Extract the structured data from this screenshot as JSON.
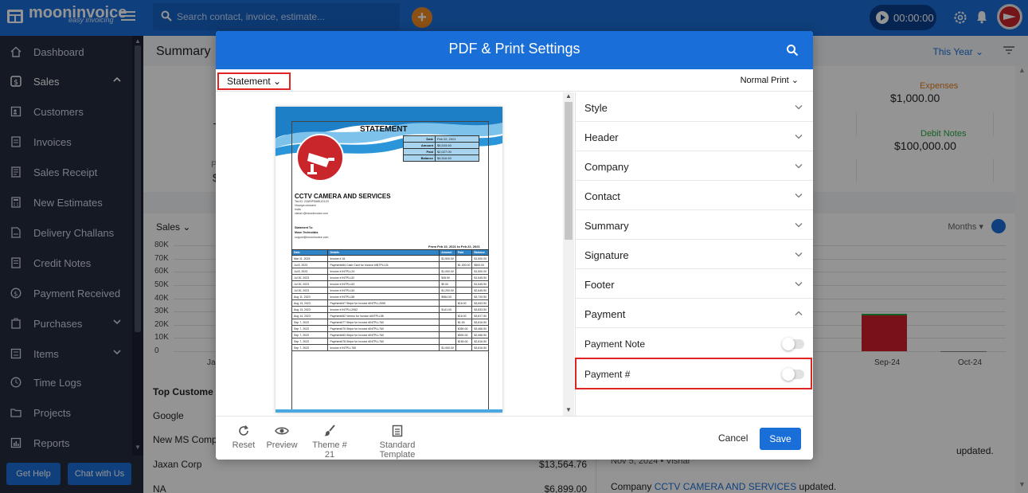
{
  "app": {
    "name": "mooninvoice",
    "tagline": "easy invoicing",
    "search_placeholder": "Search contact, invoice, estimate...",
    "timer": "00:00:00",
    "accent_color": "#1a6ed8"
  },
  "sidebar": {
    "items": [
      {
        "label": "Dashboard",
        "icon": "home-icon"
      },
      {
        "label": "Sales",
        "icon": "dollar-icon",
        "chevron": "up"
      },
      {
        "label": "Customers",
        "icon": "contact-card-icon"
      },
      {
        "label": "Invoices",
        "icon": "document-icon"
      },
      {
        "label": "Sales Receipt",
        "icon": "receipt-icon"
      },
      {
        "label": "New Estimates",
        "icon": "calculator-icon"
      },
      {
        "label": "Delivery Challans",
        "icon": "delivery-icon"
      },
      {
        "label": "Credit Notes",
        "icon": "note-icon"
      },
      {
        "label": "Payment Received",
        "icon": "payment-icon"
      },
      {
        "label": "Purchases",
        "icon": "purchase-icon",
        "chevron": "down"
      },
      {
        "label": "Items",
        "icon": "items-icon",
        "chevron": "down"
      },
      {
        "label": "Time Logs",
        "icon": "clock-icon"
      },
      {
        "label": "Projects",
        "icon": "folder-icon"
      },
      {
        "label": "Reports",
        "icon": "chart-icon"
      }
    ],
    "help_label": "Get Help",
    "chat_label": "Chat with Us"
  },
  "dashboard": {
    "summary_title": "Summary",
    "period": "This Year",
    "expenses_label": "Expenses",
    "expenses_value": "$1,000.00",
    "debit_notes_label": "Debit Notes",
    "debit_notes_value": "$100,000.00",
    "peek_label": "Pu",
    "peek_value": "$",
    "sales_label": "Sales",
    "months_label": "Months",
    "top_customers_title": "Top Custome",
    "top_customers": [
      {
        "name": "Google",
        "amount": ""
      },
      {
        "name": "New MS Comp",
        "amount": ""
      },
      {
        "name": "Jaxan Corp",
        "amount": "$13,564.76"
      },
      {
        "name": "NA",
        "amount": "$6,899.00"
      }
    ],
    "activity": {
      "updated_suffix": "updated.",
      "meta": "Nov 5, 2024 • Vishal",
      "line_prefix": "Company",
      "line_link": "CCTV CAMERA AND SERVICES",
      "line_suffix": "updated."
    }
  },
  "chart_data": {
    "type": "bar",
    "title": "Sales",
    "y_ticks": [
      "80K",
      "70K",
      "60K",
      "50K",
      "40K",
      "30K",
      "20K",
      "10K",
      "0"
    ],
    "ylim": [
      0,
      80000
    ],
    "categories_visible": [
      "Ja",
      "Sep-24",
      "Oct-24"
    ],
    "series": [
      {
        "color": "#cf1f2a",
        "values": {
          "Sep-24": 27000
        }
      },
      {
        "color": "#27a743",
        "values": {
          "Sep-24": 1500
        }
      }
    ],
    "grid": true
  },
  "modal": {
    "title": "PDF & Print Settings",
    "template_type": "Statement",
    "print_mode": "Normal Print",
    "settings": [
      {
        "label": "Style",
        "chevron": "down"
      },
      {
        "label": "Header",
        "chevron": "down"
      },
      {
        "label": "Company",
        "chevron": "down"
      },
      {
        "label": "Contact",
        "chevron": "down"
      },
      {
        "label": "Summary",
        "chevron": "down"
      },
      {
        "label": "Signature",
        "chevron": "down"
      },
      {
        "label": "Footer",
        "chevron": "down"
      },
      {
        "label": "Payment",
        "chevron": "up"
      }
    ],
    "payment_options": [
      {
        "label": "Payment Note",
        "enabled": false
      },
      {
        "label": "Payment #",
        "enabled": false
      }
    ],
    "footer": {
      "reset": "Reset",
      "preview": "Preview",
      "theme": "Theme # 21",
      "template": "Standard Template",
      "cancel": "Cancel",
      "save": "Save"
    }
  },
  "statement_doc": {
    "title": "STATEMENT",
    "meta": [
      {
        "k": "Date",
        "v": "Feb 22, 2021"
      },
      {
        "k": "Amount",
        "v": "$6,543.60"
      },
      {
        "k": "Paid",
        "v": "$2,027.00"
      },
      {
        "k": "Balance",
        "v": "$4,516.60"
      }
    ],
    "company": "CCTV CAMERA AND SERVICES",
    "company_lines": [
      "Tax ID: 22ARIPS6851G1ZX",
      "Visanya cressent",
      "India",
      "vishal.r@mooninvoice.com"
    ],
    "to_label": "Statement To:",
    "to_lines": [
      "Moon Technolabs",
      "support@mooninvoice.com"
    ],
    "period": "From Feb 22, 2021 to Feb 22, 2021",
    "columns": [
      "Date",
      "Details",
      "Amount",
      "Paid",
      "Balance"
    ],
    "rows": [
      [
        "Mar 11, 2023",
        "Invoice # 16",
        "$1,500.00",
        "",
        "$1,500.00"
      ],
      [
        "Jul 8, 2023",
        "Payment#64 Cash Card for Invoice #INTPLL24",
        "",
        "$1,000.00",
        "$500.00"
      ],
      [
        "Jul 8, 2023",
        "Invoice # INTPLL24",
        "$1,000.00",
        "",
        "$1,500.00"
      ],
      [
        "Jul 30, 2023",
        "Invoice # INTPLL52",
        "$45.50",
        "",
        "$1,545.50"
      ],
      [
        "Jul 30, 2023",
        "Invoice # INTPLL53",
        "$0.00",
        "",
        "$1,545.50"
      ],
      [
        "Jul 30, 2023",
        "Invoice # INTPLL54",
        "$1,200.00",
        "",
        "$2,645.50"
      ],
      [
        "Aug 11, 2023",
        "Invoice # INTPLL58",
        "$984.00",
        "",
        "$3,729.50"
      ],
      [
        "Aug 13, 2023",
        "Payment#47 Stripe for Invoice #INTPLL2055",
        "",
        "$16.00",
        "$3,693.50"
      ],
      [
        "Aug 13, 2023",
        "Invoice # INTPLL2062",
        "$141.00",
        "",
        "$3,833.50"
      ],
      [
        "Aug 14, 2023",
        "Payment#52 Venmo for Invoice #INTPLL58",
        "",
        "$16.00",
        "$3,817.50"
      ],
      [
        "Sep 7, 2023",
        "Payment#77 Stripe for Invoice #INTPLL760",
        "",
        "$1.00",
        "$3,816.50"
      ],
      [
        "Sep 7, 2023",
        "Payment#75 Stripe for Invoice #INTPLL760",
        "",
        "$350.00",
        "$3,466.50"
      ],
      [
        "Sep 7, 2023",
        "Payment#63 Stripe for Invoice #INTPLL760",
        "",
        "$500.00",
        "$2,966.50"
      ],
      [
        "Sep 7, 2023",
        "Payment#78 Stripe for Invoice #INTPLL760",
        "",
        "$150.00",
        "$2,816.50"
      ],
      [
        "Sep 7, 2023",
        "Invoice # INTPLL760",
        "$1,000.00",
        "",
        "$3,816.50"
      ]
    ]
  }
}
